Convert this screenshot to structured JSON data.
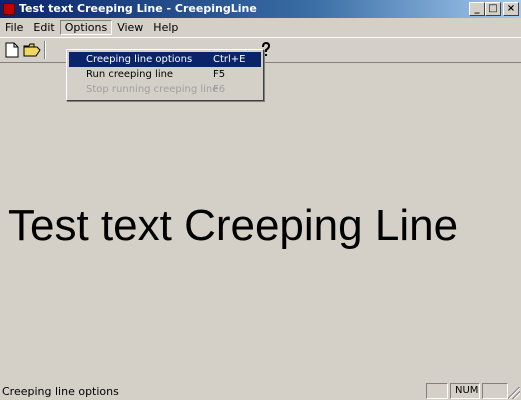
{
  "window": {
    "title": "Test text Creeping Line - CreepingLine",
    "minimize_symbol": "_",
    "maximize_symbol": "□",
    "close_symbol": "×"
  },
  "menubar": {
    "items": [
      {
        "label": "File"
      },
      {
        "label": "Edit"
      },
      {
        "label": "Options"
      },
      {
        "label": "View"
      },
      {
        "label": "Help"
      }
    ]
  },
  "toolbar": {
    "icons": [
      "new-document-icon",
      "open-folder-icon",
      "help-icon"
    ]
  },
  "options_menu": {
    "items": [
      {
        "label": "Creeping line options",
        "shortcut": "Ctrl+E",
        "state": "selected"
      },
      {
        "label": "Run creeping line",
        "shortcut": "F5",
        "state": "enabled"
      },
      {
        "label": "Stop running creeping line",
        "shortcut": "F6",
        "state": "disabled"
      }
    ]
  },
  "content": {
    "creeping_text": "Test text Creeping Line"
  },
  "statusbar": {
    "message": "Creeping line options",
    "num_indicator": "NUM"
  },
  "colors": {
    "face": "#d4d0c8",
    "title_active": "#0a246a",
    "menu_highlight": "#0a246a",
    "disabled_text": "#a0a0a0"
  }
}
